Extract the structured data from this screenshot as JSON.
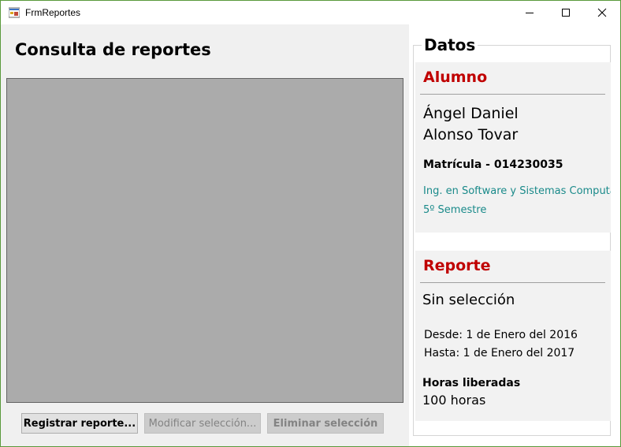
{
  "window": {
    "title": "FrmReportes"
  },
  "left": {
    "title": "Consulta de reportes",
    "buttons": {
      "register": "Registrar reporte...",
      "modify": "Modificar selección...",
      "delete": "Eliminar selección"
    }
  },
  "datos": {
    "legend": "Datos",
    "alumno": {
      "title": "Alumno",
      "name_line1": "Ángel Daniel",
      "name_line2": "Alonso Tovar",
      "matricula": "Matrícula - 014230035",
      "career": "Ing. en Software y Sistemas Computacionales",
      "semester": "5º Semestre"
    },
    "reporte": {
      "title": "Reporte",
      "selection": "Sin selección",
      "desde": "Desde: 1 de Enero del 2016",
      "hasta": "Hasta: 1 de Enero del 2017",
      "hours_label": "Horas liberadas",
      "hours_value": "100 horas"
    }
  },
  "colors": {
    "section_title": "#c00000",
    "career_text": "#1a8a8a",
    "grid_background": "#ababab"
  },
  "icons": [
    "app-icon",
    "minimize-icon",
    "maximize-icon",
    "close-icon"
  ]
}
